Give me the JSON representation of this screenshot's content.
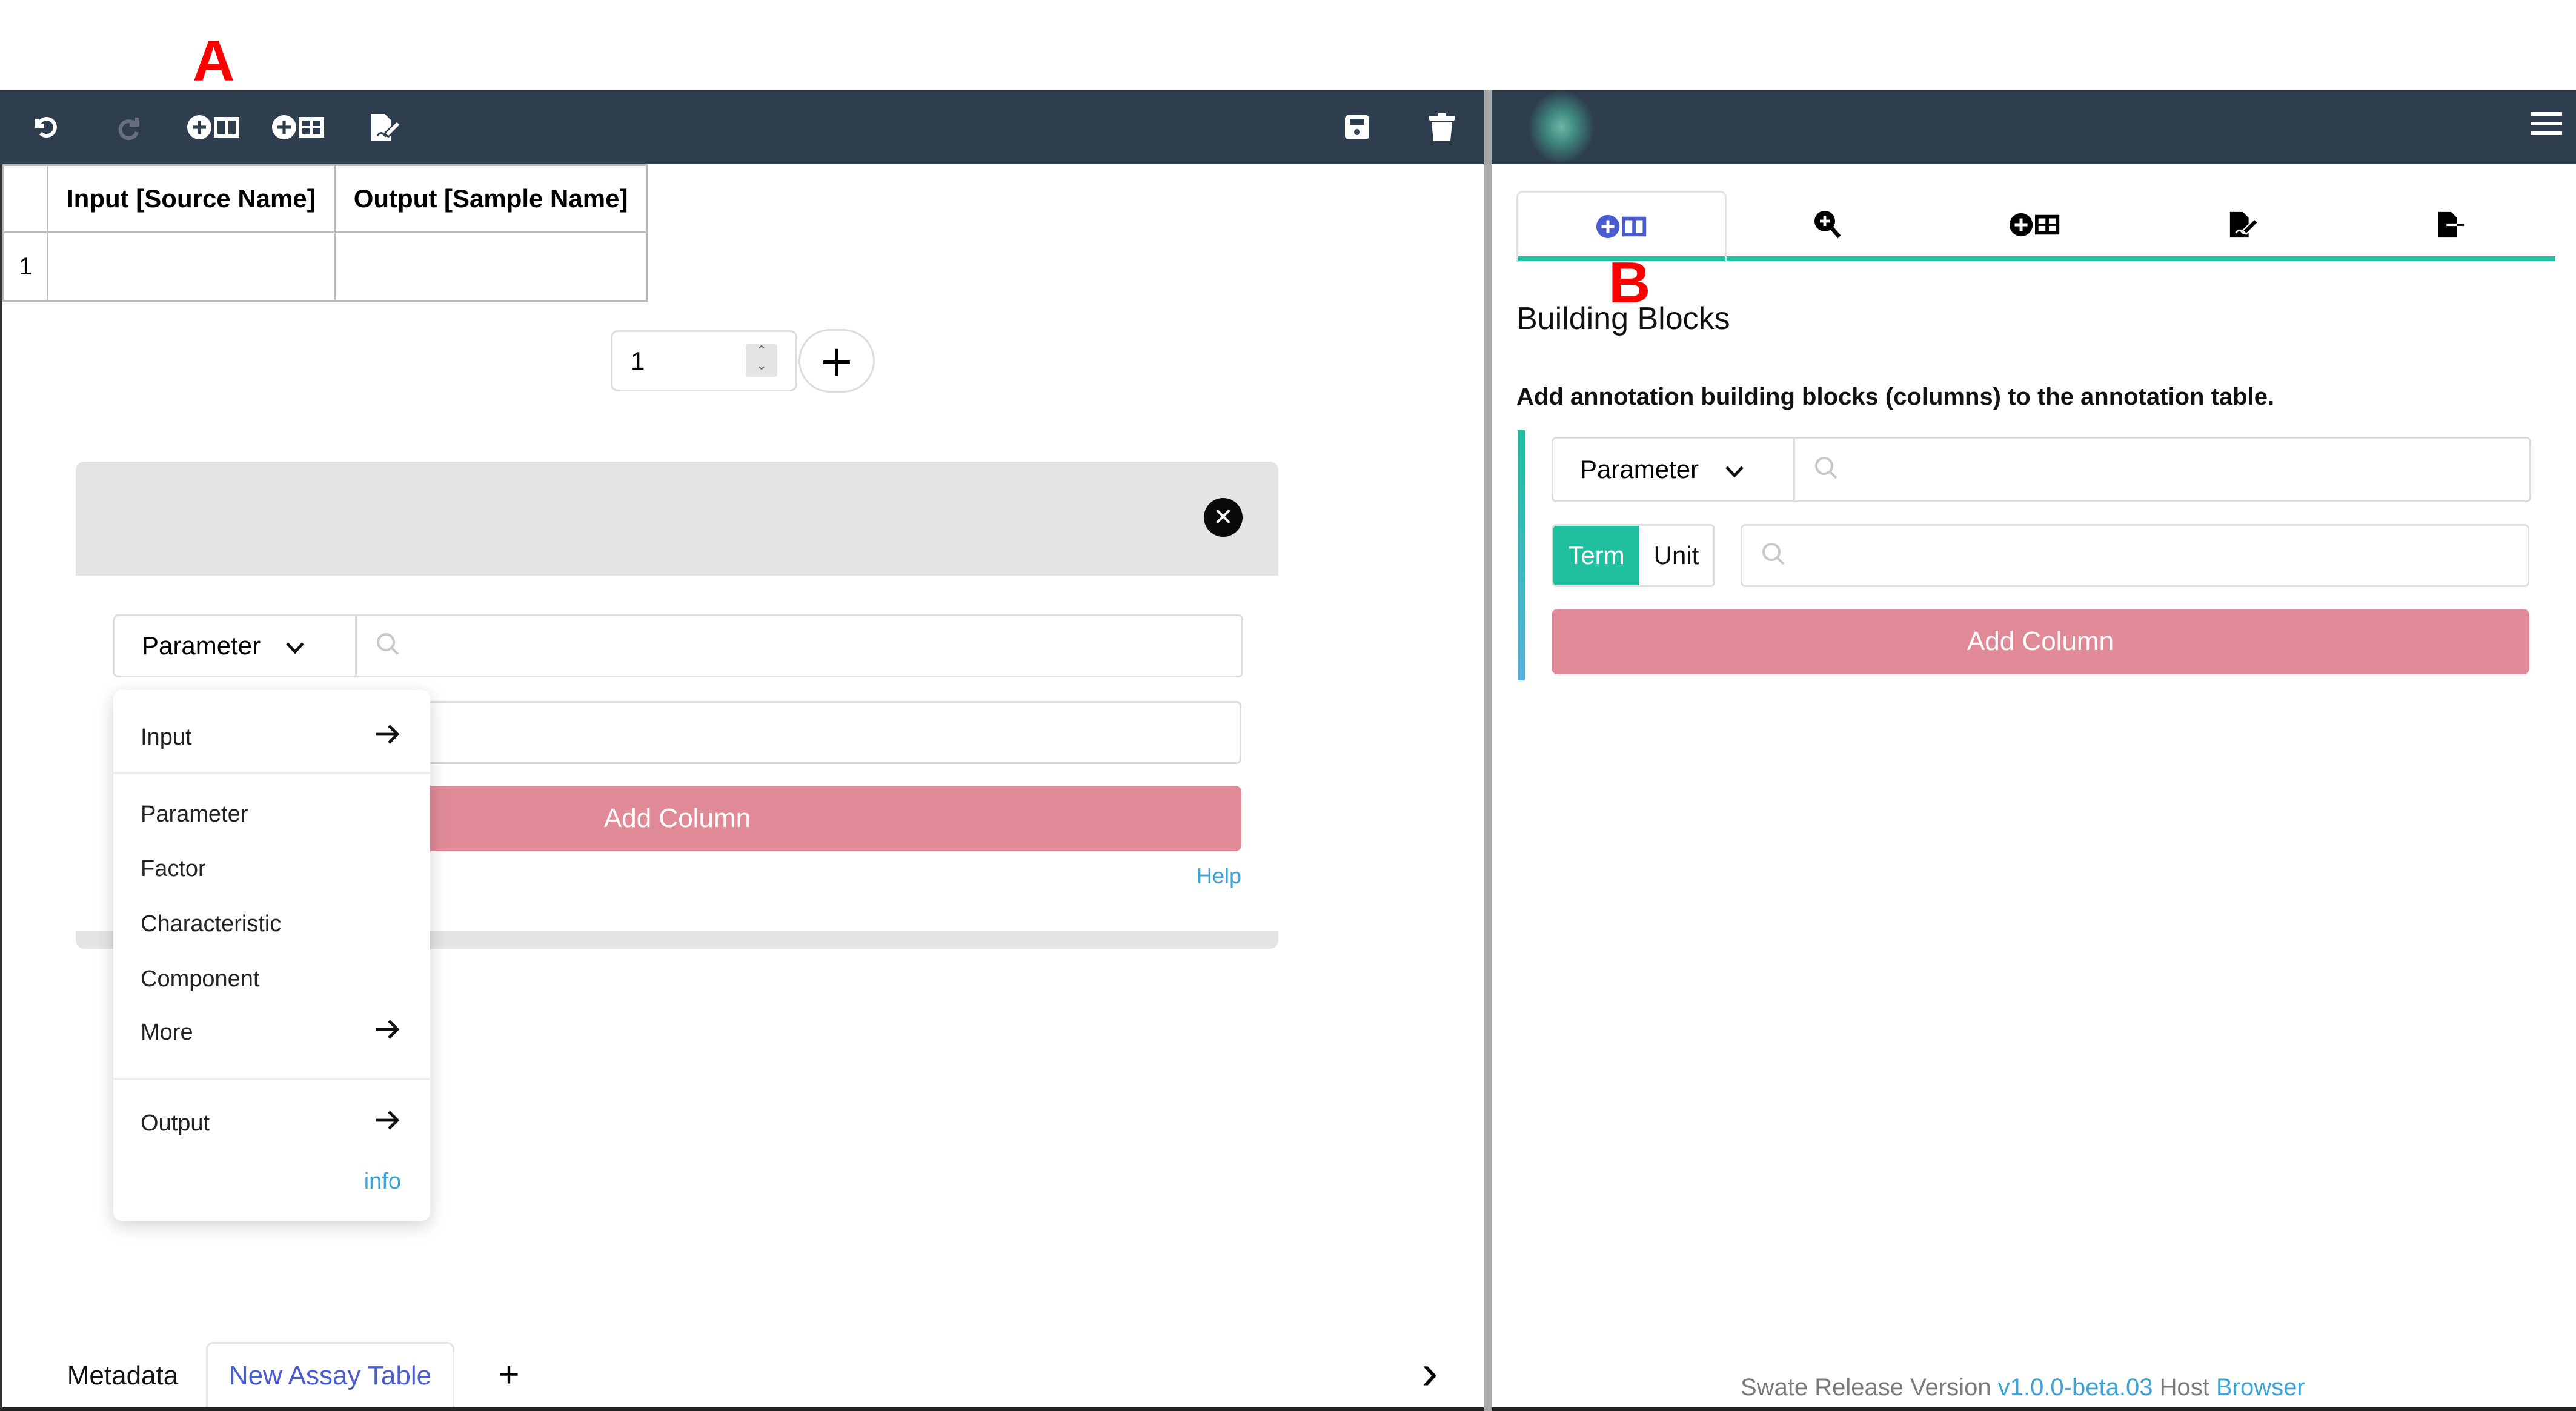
{
  "annotations": {
    "a": "A",
    "b": "B"
  },
  "left_toolbar": {
    "icons": [
      "undo-icon",
      "redo-icon",
      "add-building-block-icon",
      "add-template-icon",
      "file-signature-icon",
      "save-icon",
      "trash-icon"
    ]
  },
  "table": {
    "headers": [
      "",
      "Input [Source Name]",
      "Output [Sample Name]"
    ],
    "rows": [
      [
        "1",
        "",
        ""
      ]
    ]
  },
  "row_stepper": {
    "value": "1",
    "add_label": "+"
  },
  "card": {
    "dropdown_selected": "Parameter",
    "search_placeholder": "",
    "add_column_label": "Add Column",
    "help_label": "Help"
  },
  "dropdown_menu": {
    "items": [
      {
        "label": "Input",
        "submenu": true
      },
      {
        "label": "Parameter",
        "submenu": false
      },
      {
        "label": "Factor",
        "submenu": false
      },
      {
        "label": "Characteristic",
        "submenu": false
      },
      {
        "label": "Component",
        "submenu": false
      },
      {
        "label": "More",
        "submenu": true
      },
      {
        "label": "Output",
        "submenu": true
      }
    ],
    "info_label": "info"
  },
  "bottom_tabs": {
    "tabs": [
      {
        "label": "Metadata",
        "active": false
      },
      {
        "label": "New Assay Table",
        "active": true
      }
    ],
    "add_label": "+",
    "next_label": "›"
  },
  "right_panel": {
    "tabs": [
      "building-blocks",
      "term-search",
      "templates",
      "file-signature",
      "export"
    ],
    "active_tab": 0,
    "heading": "Building Blocks",
    "description": "Add annotation building blocks (columns) to the annotation table.",
    "dropdown_selected": "Parameter",
    "toggle": {
      "term": "Term",
      "unit": "Unit",
      "active": "Term"
    },
    "add_column_label": "Add Column",
    "footer": {
      "prefix": "Swate Release Version",
      "version": "v1.0.0-beta.03",
      "host_label": "Host",
      "host": "Browser"
    }
  },
  "colors": {
    "navbar": "#2f3e4f",
    "accent_teal": "#1fbf9f",
    "add_column": "#e08a97",
    "link": "#3ea3d6",
    "active_icon": "#4a5bd0"
  }
}
